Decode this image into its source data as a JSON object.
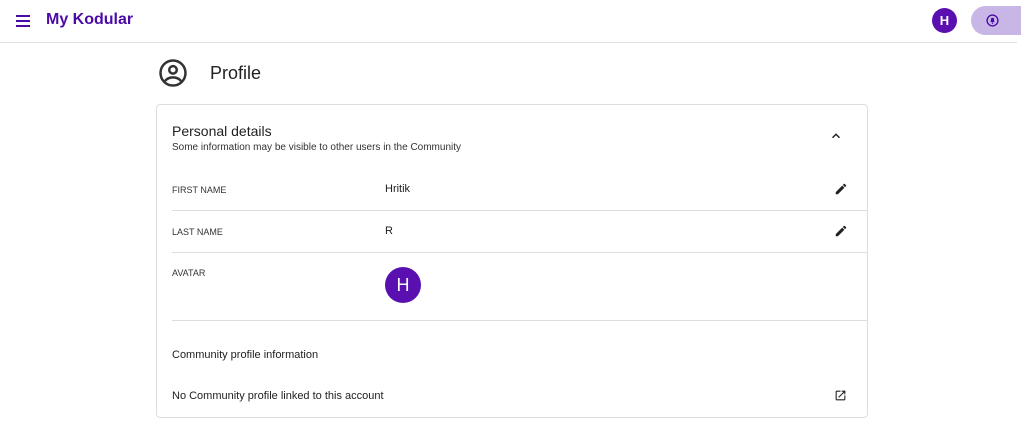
{
  "header": {
    "brand": "My Kodular",
    "avatar_initial": "H",
    "menu_icon": "hamburger-icon",
    "notification_icon": "bell-icon"
  },
  "page": {
    "title": "Profile",
    "icon": "account-circle-icon"
  },
  "personal": {
    "title": "Personal details",
    "subtitle": "Some information may be visible to other users in the Community",
    "first_name_label": "FIRST NAME",
    "first_name": "Hritik",
    "last_name_label": "LAST NAME",
    "last_name": "R",
    "avatar_label": "AVATAR",
    "avatar_initial": "H"
  },
  "community": {
    "title": "Community profile information",
    "status": "No Community profile linked to this account"
  },
  "colors": {
    "brand": "#4a0aa8",
    "avatar": "#5a0fb0",
    "notif_bg": "#c8b6e6"
  }
}
